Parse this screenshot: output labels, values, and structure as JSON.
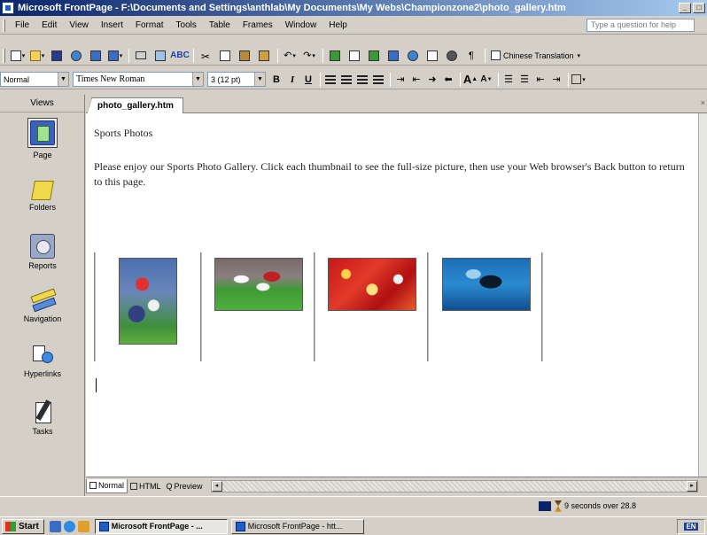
{
  "window": {
    "title": "Microsoft FrontPage - F:\\Documents and Settings\\anthlab\\My Documents\\My Webs\\Championzone2\\photo_gallery.htm"
  },
  "menubar": {
    "items": [
      "File",
      "Edit",
      "View",
      "Insert",
      "Format",
      "Tools",
      "Table",
      "Frames",
      "Window",
      "Help"
    ],
    "question_placeholder": "Type a question for help"
  },
  "toolbar": {
    "translation_label": "Chinese Translation"
  },
  "formatbar": {
    "style": "Normal",
    "font": "Times New Roman",
    "size": "3 (12 pt)"
  },
  "views": {
    "header": "Views",
    "items": [
      {
        "label": "Page",
        "icon": "page-view-icon"
      },
      {
        "label": "Folders",
        "icon": "folder-icon"
      },
      {
        "label": "Reports",
        "icon": "reports-icon"
      },
      {
        "label": "Navigation",
        "icon": "navigation-icon"
      },
      {
        "label": "Hyperlinks",
        "icon": "hyperlinks-icon"
      },
      {
        "label": "Tasks",
        "icon": "tasks-icon"
      }
    ]
  },
  "document": {
    "tab_label": "photo_gallery.htm",
    "heading": "Sports Photos",
    "intro": "Please enjoy our Sports Photo Gallery. Click each thumbnail to see the full-size picture, then use your Web browser's Back button to return to this page.",
    "thumbnails": [
      {
        "subject": "soccer-header-photo"
      },
      {
        "subject": "soccer-tackle-photo"
      },
      {
        "subject": "fans-crowd-photo"
      },
      {
        "subject": "goalkeeper-dive-photo"
      }
    ]
  },
  "view_tabs": {
    "normal": "Normal",
    "html": "HTML",
    "preview": "Preview"
  },
  "status": {
    "download_time": "9 seconds over 28.8"
  },
  "taskbar": {
    "start_label": "Start",
    "tasks": [
      "Microsoft FrontPage - ...",
      "Microsoft FrontPage - htt..."
    ],
    "language": "EN"
  },
  "colors": {
    "titlebar_start": "#0a246a",
    "titlebar_end": "#a6caf0",
    "chrome": "#d4d0c8"
  }
}
